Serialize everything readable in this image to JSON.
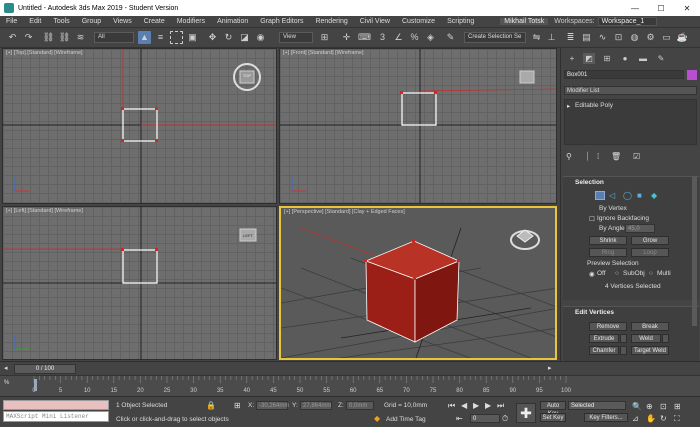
{
  "window": {
    "title": "Untitled - Autodesk 3ds Max 2019 - Student Version",
    "min": "—",
    "max": "☐",
    "close": "✕"
  },
  "menu": {
    "items": [
      "File",
      "Edit",
      "Tools",
      "Group",
      "Views",
      "Create",
      "Modifiers",
      "Animation",
      "Graph Editors",
      "Rendering",
      "Civil View",
      "Customize",
      "Scripting"
    ],
    "user": "Mikhail Totsk",
    "workspaces_label": "Workspaces:",
    "workspace": "Workspace_1"
  },
  "toolbar": {
    "filter": "All",
    "view": "View",
    "selection_set": "Create Selection Se"
  },
  "viewports": {
    "top": {
      "label": "[+] [Top] [Standard] [Wireframe]",
      "cube": "TOP"
    },
    "front": {
      "label": "[+] [Front] [Standard] [Wireframe]"
    },
    "left": {
      "label": "[+] [Left] [Standard] [Wireframe]",
      "cube": "LEFT"
    },
    "persp": {
      "label": "[+] [Perspective] [Standard] [Clay + Edged Faces]"
    }
  },
  "command_panel": {
    "object_name": "Box001",
    "modifier_list": "Modifier List",
    "stack_item": "Editable Poly",
    "selection": {
      "title": "Selection",
      "by_vertex": "By Vertex",
      "ignore_backfacing": "Ignore Backfacing",
      "by_angle": "By Angle:",
      "angle": "45,0",
      "shrink": "Shrink",
      "grow": "Grow",
      "ring": "Ring",
      "loop": "Loop",
      "preview": "Preview Selection",
      "off": "Off",
      "subobj": "SubObj",
      "multi": "Multi",
      "status": "4 Vertices Selected"
    },
    "edit_vertices": {
      "title": "Edit Vertices",
      "remove": "Remove",
      "break": "Break",
      "extrude": "Extrude",
      "weld": "Weld",
      "chamfer": "Chamfer",
      "target_weld": "Target Weld"
    }
  },
  "timeline": {
    "frame": "0 / 100",
    "ticks": [
      "0",
      "5",
      "10",
      "15",
      "20",
      "25",
      "30",
      "35",
      "40",
      "45",
      "50",
      "55",
      "60",
      "65",
      "70",
      "75",
      "80",
      "85",
      "90",
      "95",
      "100"
    ]
  },
  "status": {
    "listener": "MAXScript Mini Listener",
    "selected": "1 Object Selected",
    "prompt": "Click or click-and-drag to select objects",
    "x_label": "X:",
    "x": "-30,264mm",
    "y_label": "Y:",
    "y": "27,864mm",
    "z_label": "Z:",
    "z": "0,0mm",
    "grid": "Grid = 10,0mm",
    "add_time_tag": "Add Time Tag",
    "auto_key": "Auto Key",
    "set_key": "Set Key",
    "selected_dropdown": "Selected",
    "key_filters": "Key Filters...",
    "frame_value": "0"
  },
  "colors": {
    "accent": "#e8c53a",
    "cube": "#9b1f16",
    "swatch": "#b84fd0",
    "autokey": "#a83232"
  }
}
